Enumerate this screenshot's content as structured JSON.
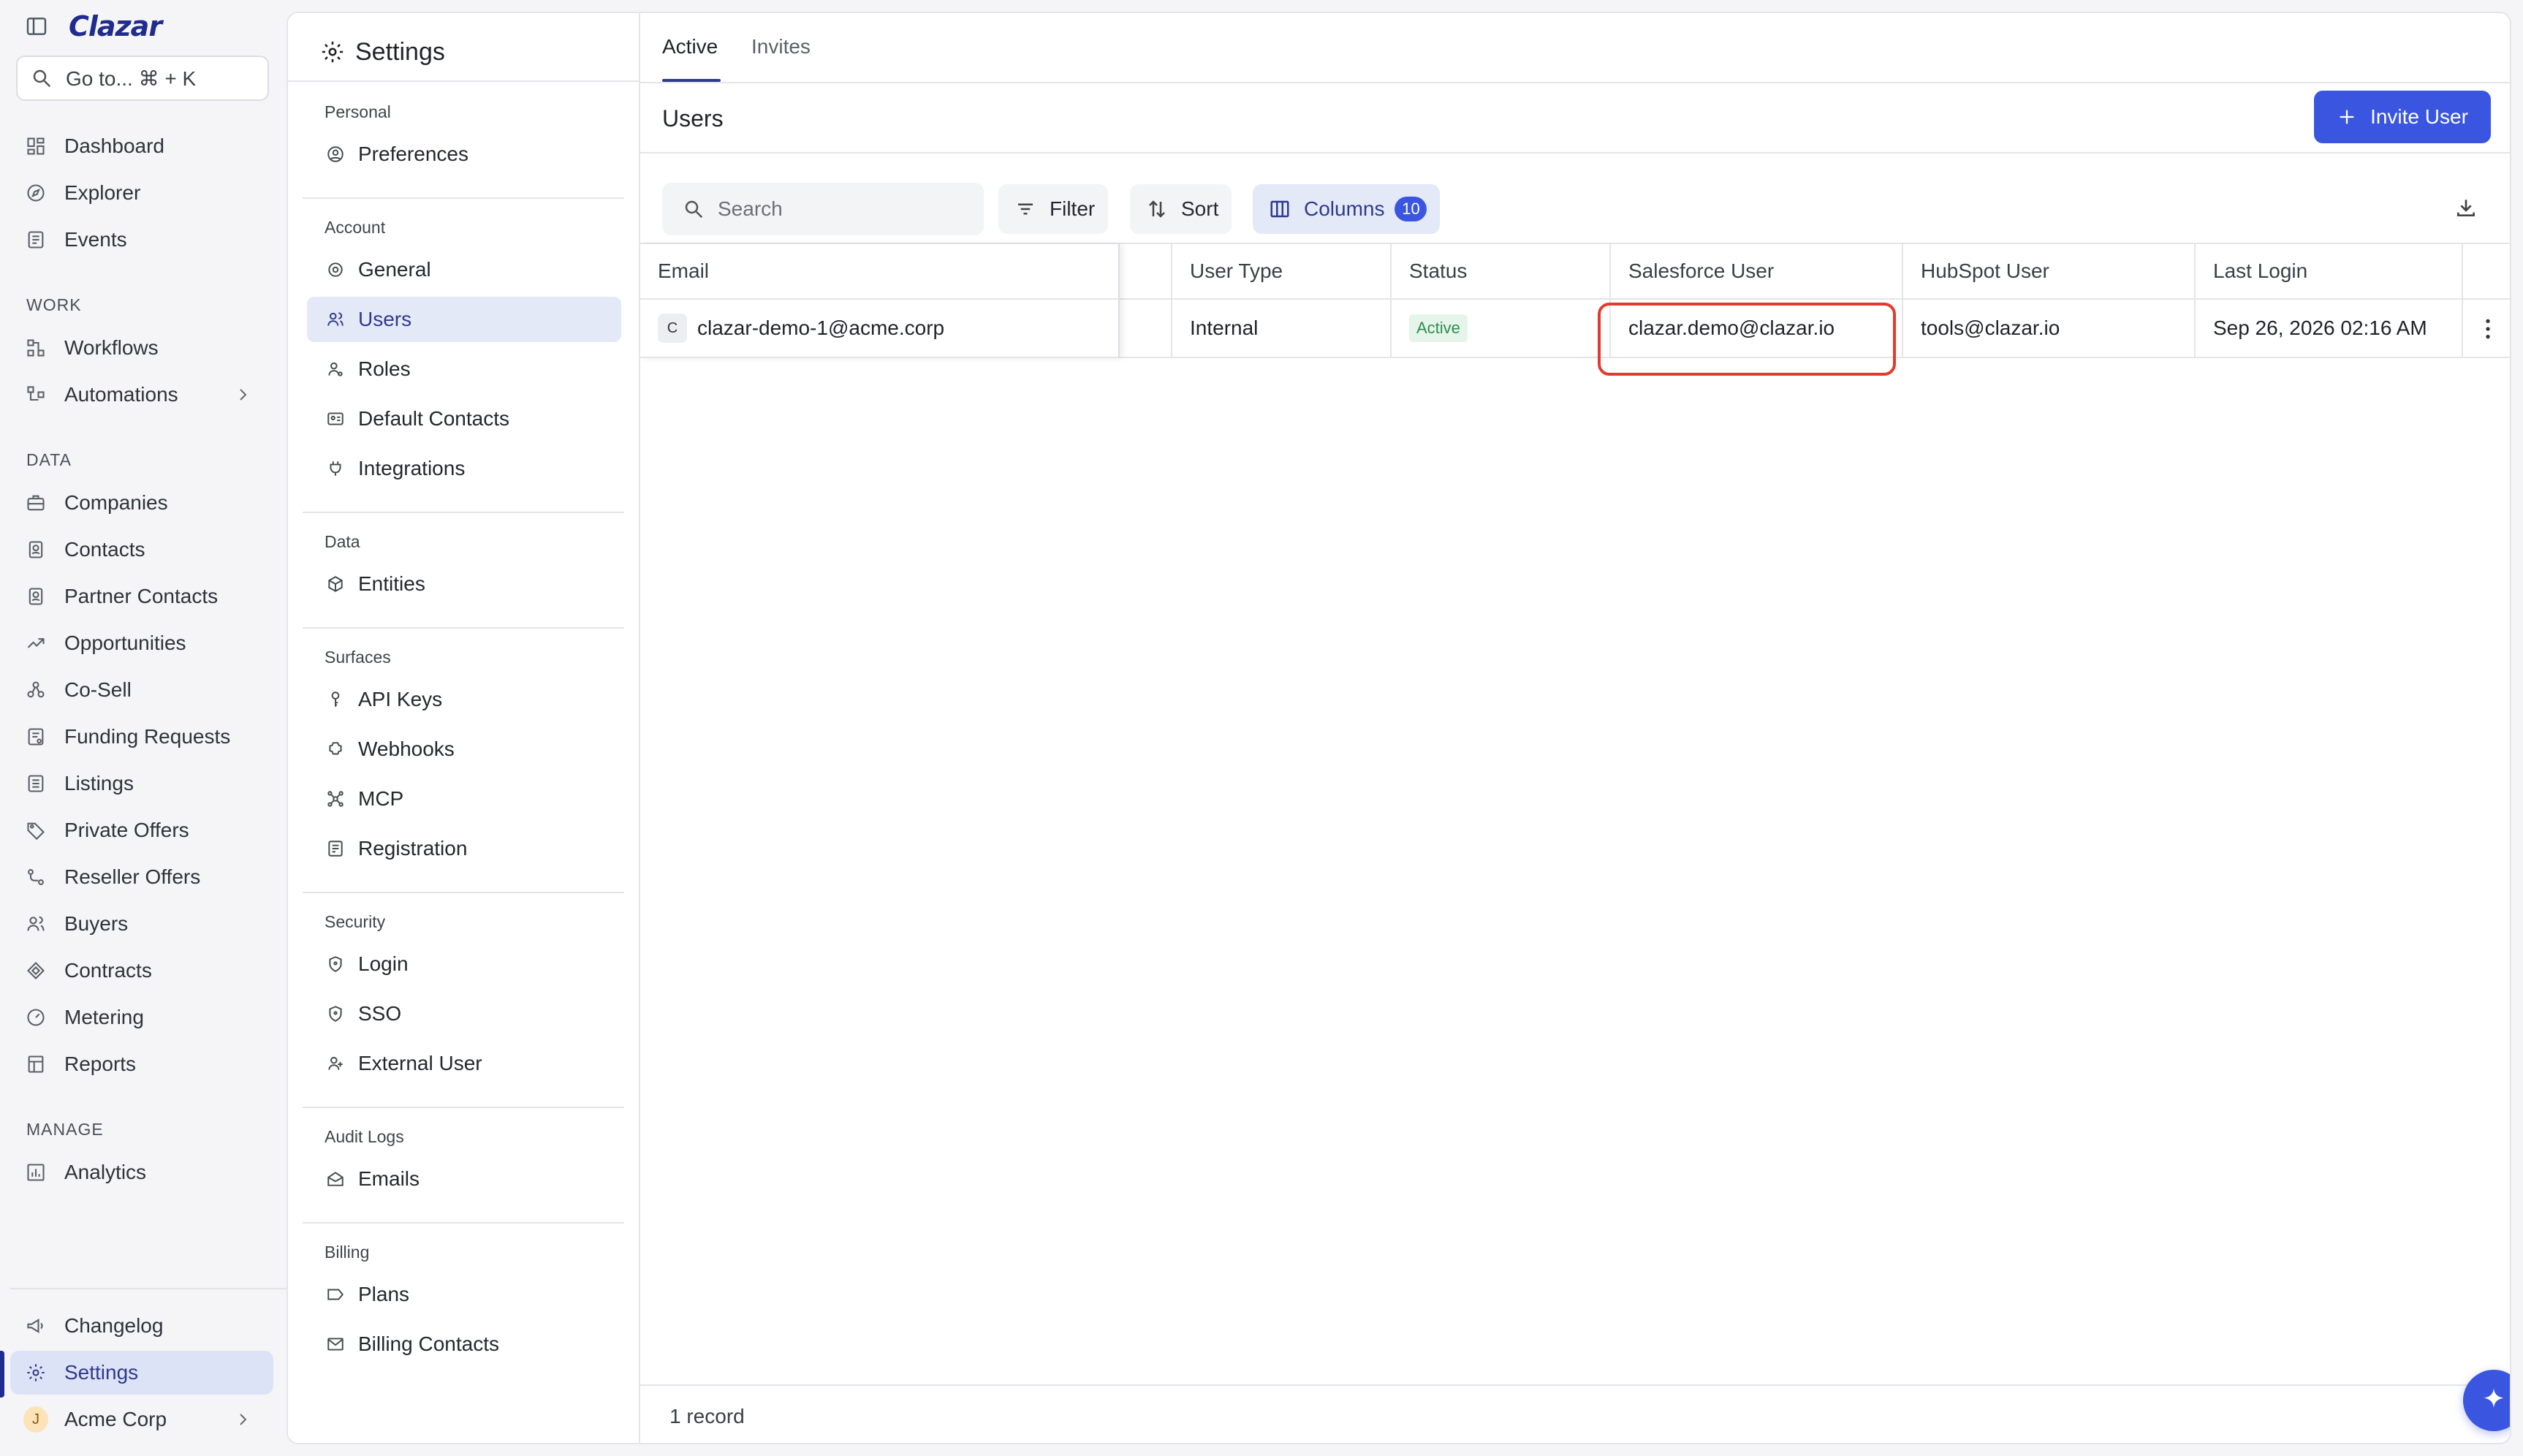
{
  "app": {
    "logo": "Clazar"
  },
  "search_bar": {
    "label": "Go to... ⌘ + K"
  },
  "nav": {
    "top_items": [
      {
        "label": "Dashboard",
        "icon": "dashboard-icon"
      },
      {
        "label": "Explorer",
        "icon": "compass-icon"
      },
      {
        "label": "Events",
        "icon": "events-icon"
      }
    ],
    "sections": [
      {
        "title": "WORK",
        "items": [
          {
            "label": "Workflows",
            "icon": "workflow-icon"
          },
          {
            "label": "Automations",
            "icon": "automation-icon"
          }
        ]
      },
      {
        "title": "DATA",
        "items": [
          {
            "label": "Companies",
            "icon": "briefcase-icon"
          },
          {
            "label": "Contacts",
            "icon": "contact-icon"
          },
          {
            "label": "Partner Contacts",
            "icon": "partner-contact-icon"
          },
          {
            "label": "Opportunities",
            "icon": "trend-icon"
          },
          {
            "label": "Co-Sell",
            "icon": "cosell-icon"
          },
          {
            "label": "Funding Requests",
            "icon": "funding-icon"
          },
          {
            "label": "Listings",
            "icon": "listing-icon"
          },
          {
            "label": "Private Offers",
            "icon": "tag-icon"
          },
          {
            "label": "Reseller Offers",
            "icon": "reseller-icon"
          },
          {
            "label": "Buyers",
            "icon": "buyers-icon"
          },
          {
            "label": "Contracts",
            "icon": "contracts-icon"
          },
          {
            "label": "Metering",
            "icon": "gauge-icon"
          },
          {
            "label": "Reports",
            "icon": "reports-icon"
          }
        ]
      },
      {
        "title": "MANAGE",
        "items": [
          {
            "label": "Analytics",
            "icon": "analytics-icon"
          }
        ]
      }
    ],
    "bottom_items": [
      {
        "label": "Changelog",
        "icon": "megaphone-icon"
      },
      {
        "label": "Settings",
        "icon": "gear-icon",
        "active": true
      },
      {
        "label": "Acme Corp",
        "avatar": "J"
      }
    ]
  },
  "settings": {
    "title": "Settings",
    "groups": [
      {
        "title": "Personal",
        "items": [
          {
            "label": "Preferences"
          }
        ]
      },
      {
        "title": "Account",
        "items": [
          {
            "label": "General"
          },
          {
            "label": "Users",
            "active": true
          },
          {
            "label": "Roles"
          },
          {
            "label": "Default Contacts"
          },
          {
            "label": "Integrations"
          }
        ]
      },
      {
        "title": "Data",
        "items": [
          {
            "label": "Entities"
          }
        ]
      },
      {
        "title": "Surfaces",
        "items": [
          {
            "label": "API Keys"
          },
          {
            "label": "Webhooks"
          },
          {
            "label": "MCP"
          },
          {
            "label": "Registration"
          }
        ]
      },
      {
        "title": "Security",
        "items": [
          {
            "label": "Login"
          },
          {
            "label": "SSO"
          },
          {
            "label": "External User"
          }
        ]
      },
      {
        "title": "Audit Logs",
        "items": [
          {
            "label": "Emails"
          }
        ]
      },
      {
        "title": "Billing",
        "items": [
          {
            "label": "Plans"
          },
          {
            "label": "Billing Contacts"
          }
        ]
      }
    ]
  },
  "tabs": [
    {
      "label": "Active",
      "active": true
    },
    {
      "label": "Invites"
    }
  ],
  "users": {
    "title": "Users",
    "invite_label": "Invite User",
    "search_placeholder": "Search",
    "filter_label": "Filter",
    "sort_label": "Sort",
    "columns_label": "Columns",
    "columns_count": "10",
    "table": {
      "headers": [
        "Email",
        "User Type",
        "Status",
        "Salesforce User",
        "HubSpot User",
        "Last Login"
      ],
      "rows": [
        {
          "avatar": "C",
          "email": "clazar-demo-1@acme.corp",
          "user_type": "Internal",
          "status": "Active",
          "salesforce_user": "clazar.demo@clazar.io",
          "hubspot_user": "tools@clazar.io",
          "last_login": "Sep 26, 2026 02:16 AM"
        }
      ]
    },
    "record_count": "1 record"
  },
  "colors": {
    "brand": "#1f2b8f",
    "accent": "#3a56e0",
    "active_bg": "#dde3f6",
    "status_active": "#2e8b4e",
    "highlight": "#e23b2e"
  }
}
